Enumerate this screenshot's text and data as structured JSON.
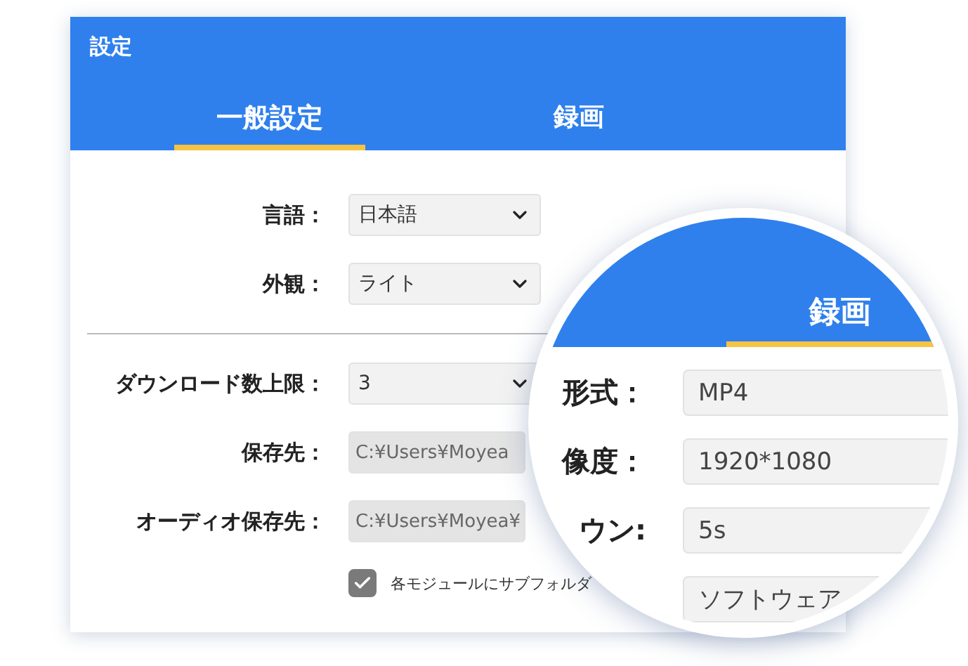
{
  "window": {
    "title": "設定"
  },
  "tabs": [
    {
      "label": "一般設定",
      "selected": true
    },
    {
      "label": "録画",
      "selected": false
    }
  ],
  "general_top": [
    {
      "label": "言語：",
      "value": "日本語",
      "kind": "select"
    },
    {
      "label": "外観：",
      "value": "ライト",
      "kind": "select"
    }
  ],
  "general_bottom": [
    {
      "label": "ダウンロード数上限：",
      "value": "3",
      "kind": "select"
    },
    {
      "label": "保存先：",
      "value": "C:¥Users¥Moyea",
      "kind": "path"
    },
    {
      "label": "オーディオ保存先：",
      "value": "C:¥Users¥Moyea¥",
      "kind": "path"
    }
  ],
  "subfolder_option": {
    "label": "各モジュールにサブフォルダ",
    "checked": true
  },
  "magnifier": {
    "tab": {
      "label": "録画",
      "selected": true
    },
    "rows": [
      {
        "label": "形式：",
        "value": "MP4"
      },
      {
        "label": "像度：",
        "value": "1920*1080"
      },
      {
        "label": "ウン:",
        "value": "5s"
      },
      {
        "label": "",
        "value": "ソフトウェア"
      }
    ]
  }
}
